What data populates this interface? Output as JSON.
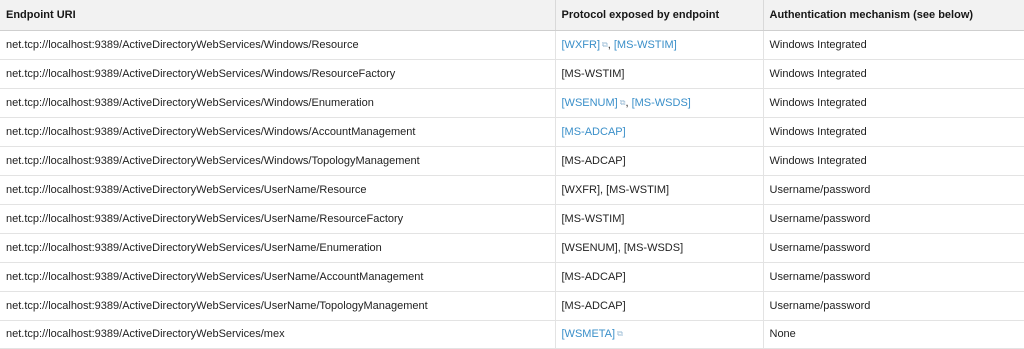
{
  "table": {
    "headers": [
      "Endpoint URI",
      "Protocol exposed by endpoint",
      "Authentication mechanism (see below)"
    ],
    "rows": [
      {
        "endpoint": "net.tcp://localhost:9389/ActiveDirectoryWebServices/Windows/Resource",
        "protocols": [
          {
            "text": "[WXFR]",
            "link": true,
            "external": true
          },
          {
            "text": "[MS-WSTIM]",
            "link": true,
            "external": false
          }
        ],
        "auth": "Windows Integrated"
      },
      {
        "endpoint": "net.tcp://localhost:9389/ActiveDirectoryWebServices/Windows/ResourceFactory",
        "protocols": [
          {
            "text": "[MS-WSTIM]",
            "link": false,
            "external": false
          }
        ],
        "auth": "Windows Integrated"
      },
      {
        "endpoint": "net.tcp://localhost:9389/ActiveDirectoryWebServices/Windows/Enumeration",
        "protocols": [
          {
            "text": "[WSENUM]",
            "link": true,
            "external": true
          },
          {
            "text": "[MS-WSDS]",
            "link": true,
            "external": false
          }
        ],
        "auth": "Windows Integrated"
      },
      {
        "endpoint": "net.tcp://localhost:9389/ActiveDirectoryWebServices/Windows/AccountManagement",
        "protocols": [
          {
            "text": "[MS-ADCAP]",
            "link": true,
            "external": false
          }
        ],
        "auth": "Windows Integrated"
      },
      {
        "endpoint": "net.tcp://localhost:9389/ActiveDirectoryWebServices/Windows/TopologyManagement",
        "protocols": [
          {
            "text": "[MS-ADCAP]",
            "link": false,
            "external": false
          }
        ],
        "auth": "Windows Integrated"
      },
      {
        "endpoint": "net.tcp://localhost:9389/ActiveDirectoryWebServices/UserName/Resource",
        "protocols": [
          {
            "text": "[WXFR]",
            "link": false,
            "external": false
          },
          {
            "text": "[MS-WSTIM]",
            "link": false,
            "external": false
          }
        ],
        "auth": "Username/password"
      },
      {
        "endpoint": "net.tcp://localhost:9389/ActiveDirectoryWebServices/UserName/ResourceFactory",
        "protocols": [
          {
            "text": "[MS-WSTIM]",
            "link": false,
            "external": false
          }
        ],
        "auth": "Username/password"
      },
      {
        "endpoint": "net.tcp://localhost:9389/ActiveDirectoryWebServices/UserName/Enumeration",
        "protocols": [
          {
            "text": "[WSENUM]",
            "link": false,
            "external": false
          },
          {
            "text": "[MS-WSDS]",
            "link": false,
            "external": false
          }
        ],
        "auth": "Username/password"
      },
      {
        "endpoint": "net.tcp://localhost:9389/ActiveDirectoryWebServices/UserName/AccountManagement",
        "protocols": [
          {
            "text": "[MS-ADCAP]",
            "link": false,
            "external": false
          }
        ],
        "auth": "Username/password"
      },
      {
        "endpoint": "net.tcp://localhost:9389/ActiveDirectoryWebServices/UserName/TopologyManagement",
        "protocols": [
          {
            "text": "[MS-ADCAP]",
            "link": false,
            "external": false
          }
        ],
        "auth": "Username/password"
      },
      {
        "endpoint": "net.tcp://localhost:9389/ActiveDirectoryWebServices/mex",
        "protocols": [
          {
            "text": "[WSMETA]",
            "link": true,
            "external": true
          }
        ],
        "auth": "None"
      }
    ],
    "separator": ", ",
    "external_icon": "external-link-icon",
    "colors": {
      "link": "#3a8fc9",
      "header_bg": "#f2f2f2"
    }
  }
}
